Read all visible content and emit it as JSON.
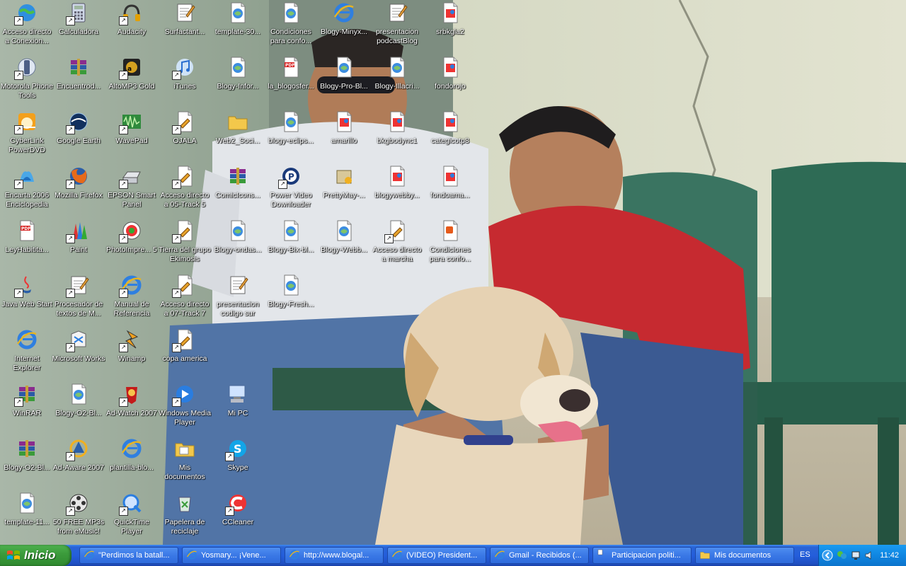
{
  "desktop": {
    "icons": [
      {
        "label": "Acceso directo a Conexion...",
        "kind": "globe",
        "shortcut": true
      },
      {
        "label": "Calculadora",
        "kind": "calculator",
        "shortcut": true
      },
      {
        "label": "Audacity",
        "kind": "headphones",
        "shortcut": true
      },
      {
        "label": "Surfactant...",
        "kind": "notepad",
        "shortcut": false
      },
      {
        "label": "template-30...",
        "kind": "html-doc",
        "shortcut": false
      },
      {
        "label": "Condiciones para confo...",
        "kind": "html-doc",
        "shortcut": false
      },
      {
        "label": "Blogy-Minyx...",
        "kind": "ie",
        "shortcut": false
      },
      {
        "label": "presentacion podcastBlog",
        "kind": "notepad",
        "shortcut": false
      },
      {
        "label": "srbkgla2",
        "kind": "image-doc",
        "shortcut": false
      },
      {
        "label": "Motorola Phone Tools",
        "kind": "phone",
        "shortcut": true
      },
      {
        "label": "Encuentrod...",
        "kind": "winrar",
        "shortcut": false
      },
      {
        "label": "AltoMP3 Gold",
        "kind": "mp3",
        "shortcut": true
      },
      {
        "label": "iTunes",
        "kind": "music",
        "shortcut": true
      },
      {
        "label": "Blogy-Infor...",
        "kind": "html-doc",
        "shortcut": false
      },
      {
        "label": "la_blogosfer...",
        "kind": "pdf",
        "shortcut": false
      },
      {
        "label": "Blogy-Pro-Bl...",
        "kind": "html-doc",
        "shortcut": false
      },
      {
        "label": "Blogy-Illacri...",
        "kind": "html-doc",
        "shortcut": false
      },
      {
        "label": "fondorojo",
        "kind": "image-doc",
        "shortcut": false
      },
      {
        "label": "CyberLink PowerDVD",
        "kind": "dvd",
        "shortcut": true
      },
      {
        "label": "Google Earth",
        "kind": "earth",
        "shortcut": true
      },
      {
        "label": "WavePad",
        "kind": "wave",
        "shortcut": true
      },
      {
        "label": "OJALA",
        "kind": "shortcut-doc",
        "shortcut": true
      },
      {
        "label": "Web2_Soci...",
        "kind": "folder",
        "shortcut": false
      },
      {
        "label": "blogy-eclips...",
        "kind": "html-doc",
        "shortcut": false
      },
      {
        "label": "amarillo",
        "kind": "image-doc",
        "shortcut": false
      },
      {
        "label": "bkgbodync1",
        "kind": "image-doc",
        "shortcut": false
      },
      {
        "label": "categicotp8",
        "kind": "image-doc",
        "shortcut": false
      },
      {
        "label": "Encarta 2006 Enciclopedia",
        "kind": "encarta",
        "shortcut": true
      },
      {
        "label": "Mozilla Firefox",
        "kind": "firefox",
        "shortcut": true
      },
      {
        "label": "EPSON Smart Panel",
        "kind": "scanner",
        "shortcut": true
      },
      {
        "label": "Acceso directo a 05-Track 5",
        "kind": "shortcut-doc",
        "shortcut": true
      },
      {
        "label": "ComicIcons...",
        "kind": "winrar",
        "shortcut": false
      },
      {
        "label": "Power Video Downloader",
        "kind": "video-dl",
        "shortcut": true
      },
      {
        "label": "PrettyMay-...",
        "kind": "installer",
        "shortcut": false
      },
      {
        "label": "blogywebby...",
        "kind": "image-doc",
        "shortcut": false
      },
      {
        "label": "fondoama...",
        "kind": "image-doc",
        "shortcut": false
      },
      {
        "label": "LeyHabitita...",
        "kind": "pdf",
        "shortcut": false
      },
      {
        "label": "Paint",
        "kind": "paint",
        "shortcut": true
      },
      {
        "label": "PhotoImpre... 5",
        "kind": "photo",
        "shortcut": true
      },
      {
        "label": "Tierra del grupo Ekimosis",
        "kind": "shortcut-doc",
        "shortcut": true
      },
      {
        "label": "Blogy-ondas...",
        "kind": "html-doc",
        "shortcut": false
      },
      {
        "label": "Blogy-Bix-bl...",
        "kind": "html-doc",
        "shortcut": false
      },
      {
        "label": "Blogy-Webb...",
        "kind": "html-doc",
        "shortcut": false
      },
      {
        "label": "Acceso directo a marcha",
        "kind": "shortcut-doc",
        "shortcut": true
      },
      {
        "label": "Condiciones para confo...",
        "kind": "office-doc",
        "shortcut": false
      },
      {
        "label": "Java Web Start",
        "kind": "java",
        "shortcut": true
      },
      {
        "label": "Procesador de textos de M...",
        "kind": "notepad",
        "shortcut": true
      },
      {
        "label": "Manual de Referencia",
        "kind": "ie",
        "shortcut": true
      },
      {
        "label": "Acceso directo a 07-Track 7",
        "kind": "shortcut-doc",
        "shortcut": true
      },
      {
        "label": "presentacion codigo sur",
        "kind": "notepad",
        "shortcut": false
      },
      {
        "label": "Blogy-Fresh...",
        "kind": "html-doc",
        "shortcut": false
      },
      {
        "label": "Internet Explorer",
        "kind": "ie",
        "shortcut": false
      },
      {
        "label": "Microsoft Works",
        "kind": "works",
        "shortcut": true
      },
      {
        "label": "Winamp",
        "kind": "winamp",
        "shortcut": true
      },
      {
        "label": "copa america",
        "kind": "shortcut-doc",
        "shortcut": true
      },
      {
        "label": "WinRAR",
        "kind": "winrar",
        "shortcut": true
      },
      {
        "label": "Blogy-O2-Bl...",
        "kind": "html-doc",
        "shortcut": false
      },
      {
        "label": "Ad-Watch 2007",
        "kind": "adwatch",
        "shortcut": true
      },
      {
        "label": "Windows Media Player",
        "kind": "wmp",
        "shortcut": true
      },
      {
        "label": "Mi PC",
        "kind": "mypc",
        "shortcut": false
      },
      {
        "label": "Blogy-O2-Bl...",
        "kind": "winrar",
        "shortcut": false
      },
      {
        "label": "Ad-Aware 2007",
        "kind": "adaware",
        "shortcut": true
      },
      {
        "label": "plantilla-blo...",
        "kind": "ie",
        "shortcut": false
      },
      {
        "label": "Mis documentos",
        "kind": "mydocs",
        "shortcut": false
      },
      {
        "label": "Skype",
        "kind": "skype",
        "shortcut": true
      },
      {
        "label": "template-11...",
        "kind": "html-doc",
        "shortcut": false
      },
      {
        "label": "50 FREE MP3s from eMusic!",
        "kind": "film",
        "shortcut": true
      },
      {
        "label": "QuickTime Player",
        "kind": "quicktime",
        "shortcut": true
      },
      {
        "label": "Papelera de reciclaje",
        "kind": "recycle",
        "shortcut": false
      },
      {
        "label": "CCleaner",
        "kind": "ccleaner",
        "shortcut": true
      }
    ]
  },
  "taskbar": {
    "start_label": "Inicio",
    "tasks": [
      {
        "label": "\"Perdimos la batall...",
        "kind": "ie"
      },
      {
        "label": "Yosmary... ¡Vene...",
        "kind": "ie"
      },
      {
        "label": "http://www.blogal...",
        "kind": "ie"
      },
      {
        "label": "(VIDEO) President...",
        "kind": "ie"
      },
      {
        "label": "Gmail - Recibidos (...",
        "kind": "ie"
      },
      {
        "label": "Participacion politi...",
        "kind": "doc"
      },
      {
        "label": "Mis documentos",
        "kind": "folder"
      }
    ],
    "language": "ES",
    "clock": "11:42"
  },
  "colors": {
    "taskbar_blue": "#245edb",
    "start_green": "#3c9c3c",
    "tray_blue": "#0f86e2"
  }
}
